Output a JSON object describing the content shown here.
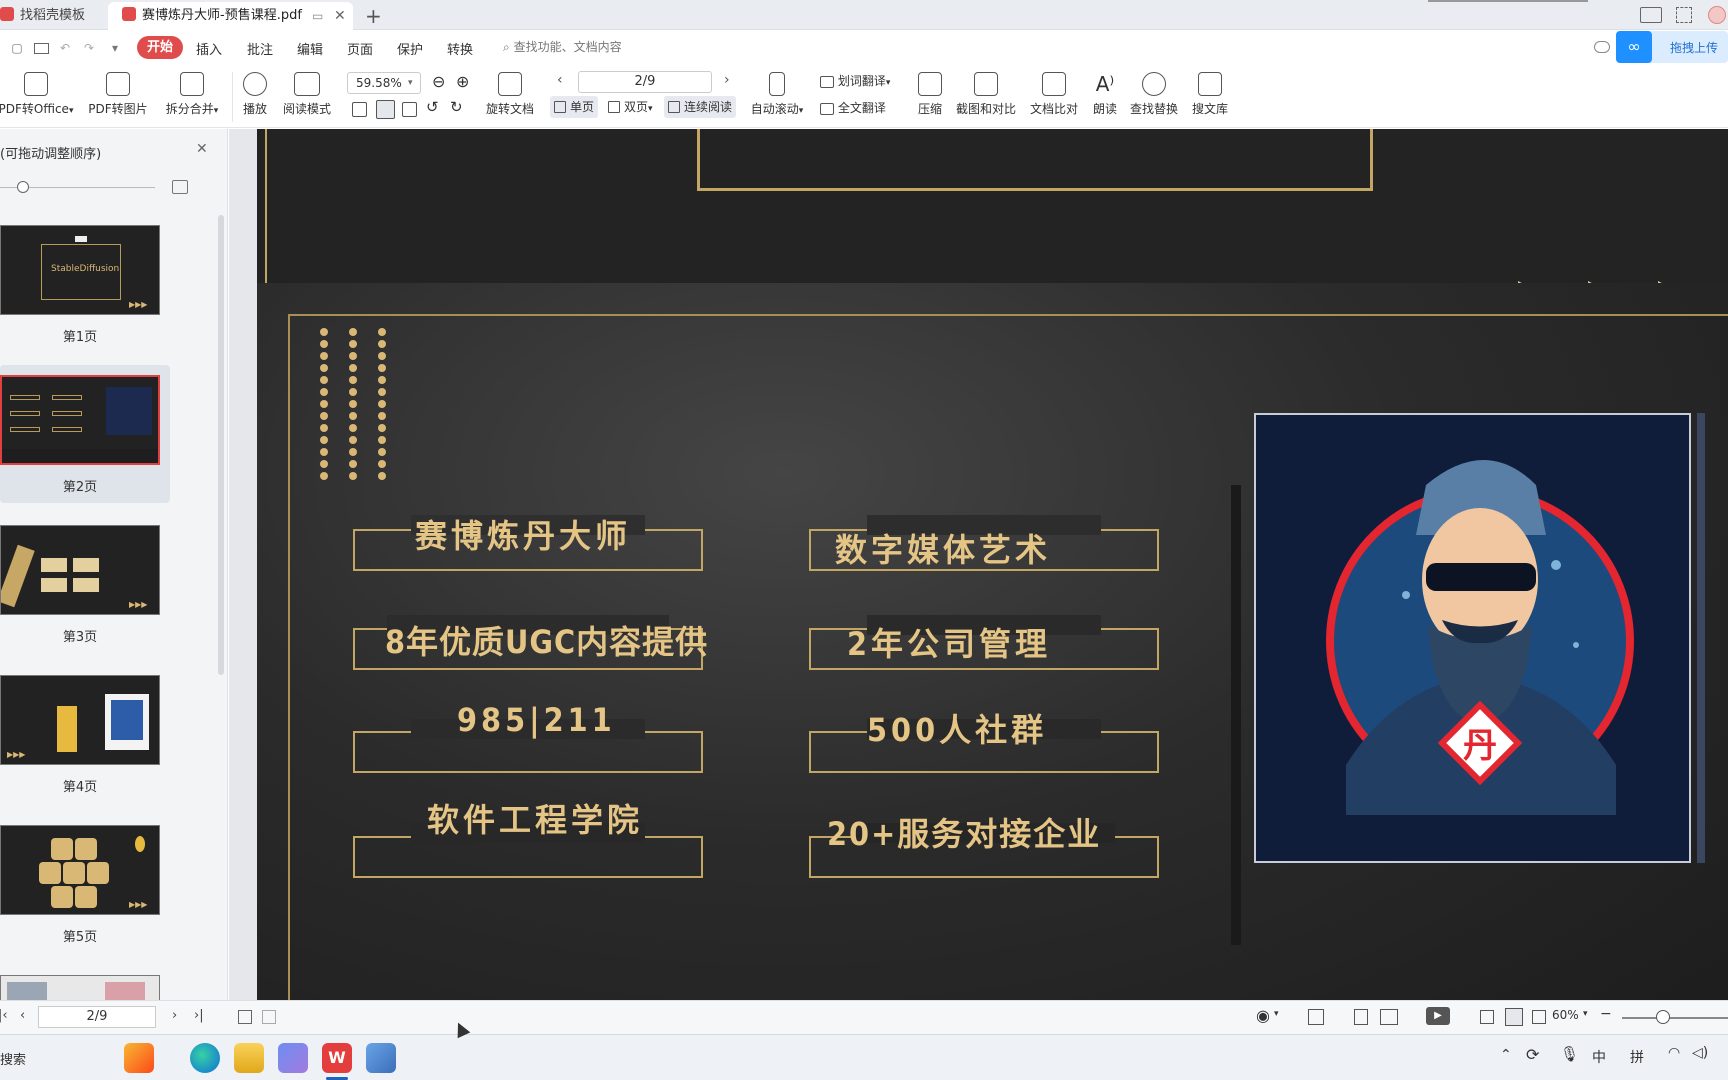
{
  "tabs": [
    {
      "label": "找稻壳模板"
    },
    {
      "label": "赛博炼丹大师-预售课程.pdf"
    }
  ],
  "menubar": {
    "start": "开始",
    "items": [
      "插入",
      "批注",
      "编辑",
      "页面",
      "保护",
      "转换"
    ],
    "search_placeholder": "查找功能、文档内容",
    "upload": "拖拽上传"
  },
  "ribbon": {
    "pdf_to_office": "PDF转Office",
    "pdf_to_image": "PDF转图片",
    "split_merge": "拆分合并",
    "play": "播放",
    "read_mode": "阅读模式",
    "zoom_value": "59.58%",
    "rotate_doc": "旋转文档",
    "page_value": "2/9",
    "single_page": "单页",
    "double_page": "双页",
    "continuous": "连续阅读",
    "auto_scroll": "自动滚动",
    "word_translate": "划词翻译",
    "full_translate": "全文翻译",
    "compress": "压缩",
    "screenshot_compare": "截图和对比",
    "doc_compare": "文档比对",
    "read_aloud": "朗读",
    "find_replace": "查找替换",
    "search_library": "搜文库"
  },
  "sidebar": {
    "title": "(可拖动调整顺序)",
    "thumbnails": [
      {
        "label": "第1页",
        "title": "StableDiffusion"
      },
      {
        "label": "第2页"
      },
      {
        "label": "第3页"
      },
      {
        "label": "第4页"
      },
      {
        "label": "第5页"
      }
    ]
  },
  "slide": {
    "left_items": [
      "赛博炼丹大师",
      "8年优质UGC内容提供",
      "985|211",
      "软件工程学院"
    ],
    "right_items": [
      "数字媒体艺术",
      "2年公司管理",
      "500人社群",
      "20+服务对接企业"
    ],
    "badge": "丹"
  },
  "statusbar": {
    "page_value": "2/9",
    "zoom": "60%"
  },
  "taskbar": {
    "search": "搜索",
    "ime_lang": "中",
    "ime_mode": "拼"
  },
  "colors": {
    "accent_red": "#e04b4b",
    "gold": "#c4a664",
    "blue_upload": "#1e90ff"
  }
}
